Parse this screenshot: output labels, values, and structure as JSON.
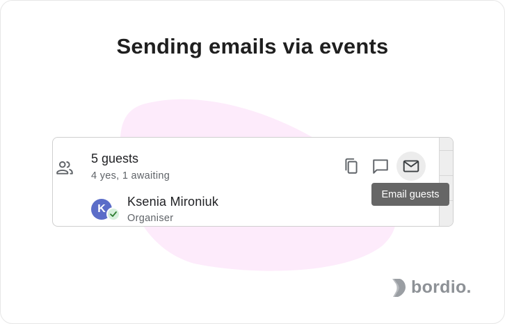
{
  "heading": "Sending emails via events",
  "guests": {
    "count_label": "5 guests",
    "status_label": "4 yes, 1 awaiting"
  },
  "actions": {
    "copy_icon": "copy-icon",
    "comment_icon": "comment-icon",
    "email_icon": "mail-icon"
  },
  "tooltip": "Email guests",
  "organiser": {
    "initial": "K",
    "name": "Ksenia Mironiuk",
    "role": "Organiser"
  },
  "brand": {
    "name": "bordio."
  },
  "colors": {
    "blob": "#fdebfb",
    "avatar": "#5b6dc8",
    "check_badge": "#d7f0dd",
    "check": "#2e7d32",
    "tooltip_bg": "#666666",
    "brand_grey": "#8d9196"
  }
}
